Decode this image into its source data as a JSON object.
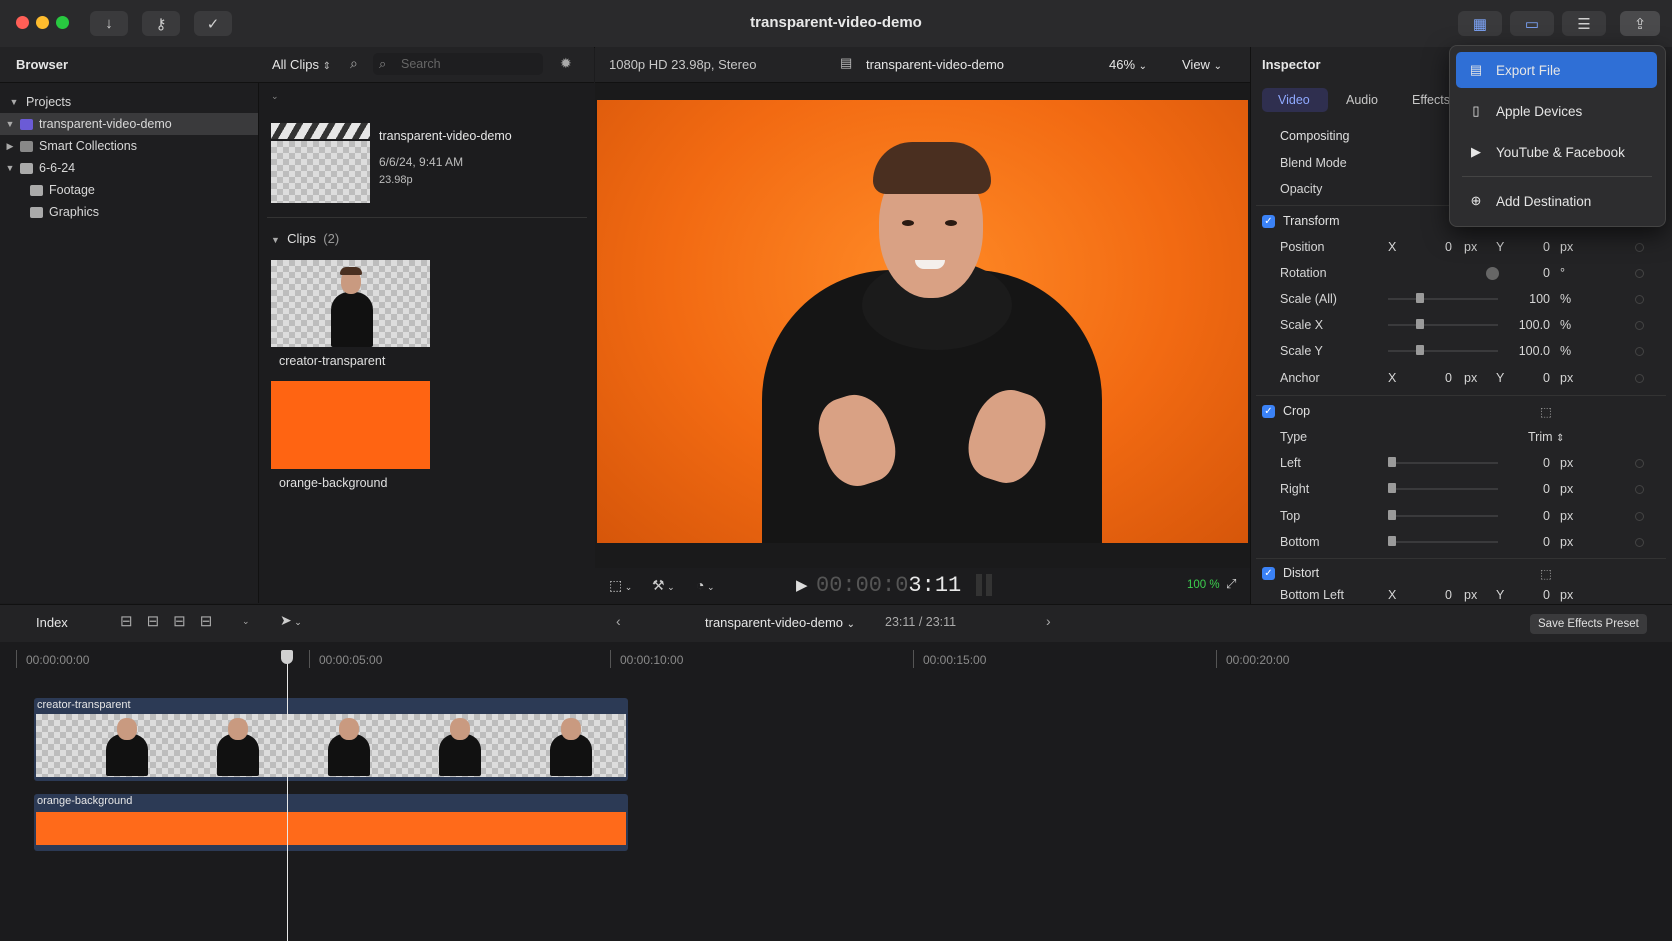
{
  "window": {
    "title": "transparent-video-demo"
  },
  "toolbar": {
    "import_icon": "download-arrow-icon",
    "keywords_icon": "key-icon",
    "background_tasks_icon": "check-circle-icon"
  },
  "browser": {
    "header": "Browser",
    "filter_label": "All Clips",
    "search_placeholder": "Search",
    "sidebar": [
      {
        "label": "Projects"
      },
      {
        "label": "transparent-video-demo"
      },
      {
        "label": "Smart Collections"
      },
      {
        "label": "6-6-24"
      },
      {
        "label": "Footage"
      },
      {
        "label": "Graphics"
      }
    ],
    "project": {
      "name": "transparent-video-demo",
      "date": "6/6/24, 9:41 AM",
      "rate": "23.98p"
    },
    "clips_header": "Clips",
    "clips_count": "(2)",
    "clips": [
      {
        "name": "creator-transparent"
      },
      {
        "name": "orange-background"
      }
    ]
  },
  "viewer": {
    "format": "1080p HD 23.98p, Stereo",
    "project_name": "transparent-video-demo",
    "zoom": "46%",
    "view_label": "View",
    "timecode_dim": "00:00:0",
    "timecode_bright": "3:11",
    "zoom_fit": "100 %"
  },
  "inspector": {
    "header": "Inspector",
    "tabs": [
      {
        "label": "Video"
      },
      {
        "label": "Audio"
      },
      {
        "label": "Effects"
      }
    ],
    "compositing": {
      "title": "Compositing",
      "blend_mode": "Blend Mode",
      "opacity": "Opacity"
    },
    "transform": {
      "title": "Transform",
      "position": {
        "label": "Position",
        "x_label": "X",
        "x": "0",
        "y_label": "Y",
        "y": "0",
        "unit": "px"
      },
      "rotation": {
        "label": "Rotation",
        "value": "0",
        "unit": "°"
      },
      "scale_all": {
        "label": "Scale (All)",
        "value": "100",
        "unit": "%"
      },
      "scale_x": {
        "label": "Scale X",
        "value": "100.0",
        "unit": "%"
      },
      "scale_y": {
        "label": "Scale Y",
        "value": "100.0",
        "unit": "%"
      },
      "anchor": {
        "label": "Anchor",
        "x_label": "X",
        "x": "0",
        "y_label": "Y",
        "y": "0",
        "unit": "px"
      }
    },
    "crop": {
      "title": "Crop",
      "type": {
        "label": "Type",
        "value": "Trim"
      },
      "left": {
        "label": "Left",
        "value": "0",
        "unit": "px"
      },
      "right": {
        "label": "Right",
        "value": "0",
        "unit": "px"
      },
      "top": {
        "label": "Top",
        "value": "0",
        "unit": "px"
      },
      "bottom": {
        "label": "Bottom",
        "value": "0",
        "unit": "px"
      }
    },
    "distort": {
      "title": "Distort",
      "bottom_left": {
        "label": "Bottom Left",
        "x_label": "X",
        "x": "0",
        "y_label": "Y",
        "y": "0",
        "unit": "px"
      }
    },
    "save_preset": "Save Effects Preset"
  },
  "share_menu": {
    "items": [
      {
        "label": "Export File",
        "icon": "document-icon"
      },
      {
        "label": "Apple Devices",
        "icon": "phone-icon"
      },
      {
        "label": "YouTube & Facebook",
        "icon": "play-icon"
      },
      {
        "label": "Add Destination",
        "icon": "plus-circle-icon"
      }
    ]
  },
  "timeline": {
    "index_label": "Index",
    "project_name": "transparent-video-demo",
    "duration": "23:11 / 23:11",
    "ruler": [
      "00:00:00:00",
      "00:00:05:00",
      "00:00:10:00",
      "00:00:15:00",
      "00:00:20:00"
    ],
    "tracks": [
      {
        "name": "creator-transparent"
      },
      {
        "name": "orange-background"
      }
    ]
  },
  "colors": {
    "accent": "#2f6fd6",
    "orange": "#ff6a1a",
    "window": "#1c1c1e"
  }
}
